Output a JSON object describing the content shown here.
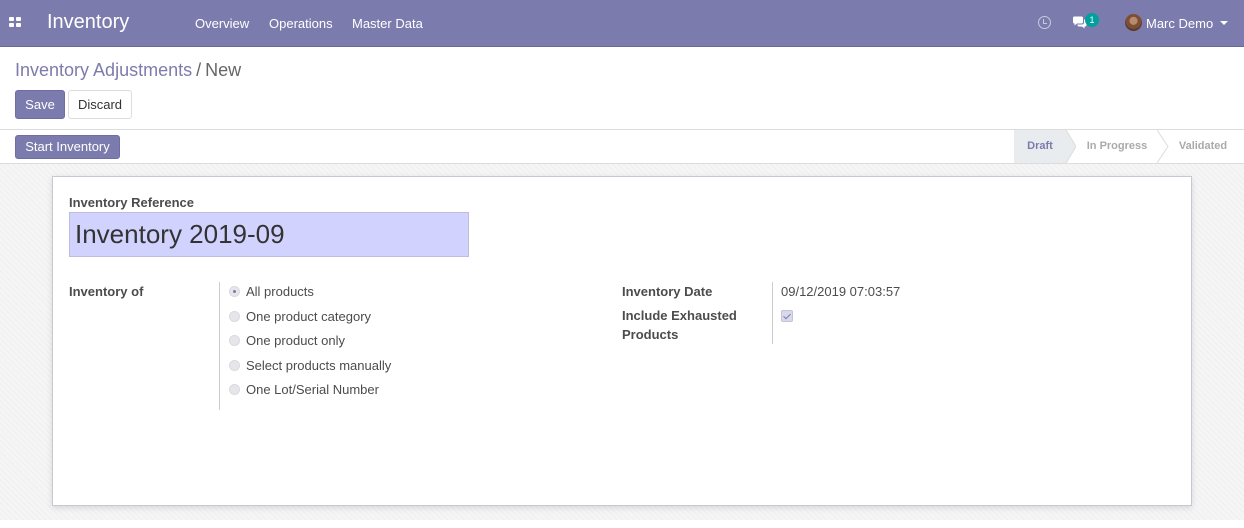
{
  "navbar": {
    "app_title": "Inventory",
    "menus": [
      "Overview",
      "Operations",
      "Master Data"
    ],
    "notification_count": "1",
    "user_name": "Marc Demo",
    "accent_color": "#7c7bad",
    "icons": {
      "apps": "apps-grid-icon",
      "activity": "clock-icon",
      "messages": "chat-icon",
      "user": "avatar"
    }
  },
  "breadcrumb": {
    "parent": "Inventory Adjustments",
    "separator": "/",
    "current": "New"
  },
  "toolbar": {
    "save_label": "Save",
    "discard_label": "Discard"
  },
  "statusbar": {
    "action_label": "Start Inventory",
    "steps": [
      "Draft",
      "In Progress",
      "Validated"
    ],
    "active_step": "Draft"
  },
  "form": {
    "reference_label": "Inventory Reference",
    "reference_value": "Inventory 2019-09",
    "inventory_of_label": "Inventory of",
    "inventory_of_options": [
      "All products",
      "One product category",
      "One product only",
      "Select products manually",
      "One Lot/Serial Number"
    ],
    "inventory_of_selected": "All products",
    "date_label": "Inventory Date",
    "date_value": "09/12/2019 07:03:57",
    "exhausted_label_line1": "Include Exhausted",
    "exhausted_label_line2": "Products",
    "exhausted_checked": true
  }
}
